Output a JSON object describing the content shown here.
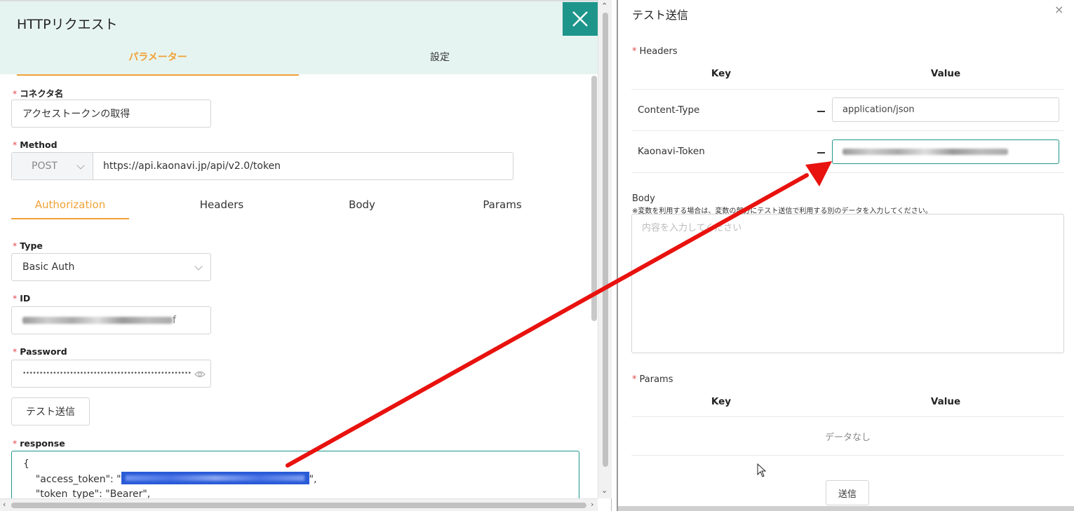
{
  "left": {
    "title": "HTTPリクエスト",
    "tabs": [
      "パラメーター",
      "設定"
    ],
    "connector_label": "コネクタ名",
    "connector_value": "アクセストークンの取得",
    "method_label": "Method",
    "method_value": "POST",
    "url_value": "https://api.kaonavi.jp/api/v2.0/token",
    "sub_tabs": [
      "Authorization",
      "Headers",
      "Body",
      "Params"
    ],
    "type_label": "Type",
    "type_value": "Basic Auth",
    "id_label": "ID",
    "id_suffix": "f",
    "password_label": "Password",
    "password_value": "••••••••••••••••••••••••••••••••••••••••••••••••••••",
    "test_button": "テスト送信",
    "response_label": "response",
    "response_line1": "{",
    "response_key1": "    \"access_token\": \"",
    "response_key1_end": "\",",
    "response_line3": "    \"token_type\": \"Bearer\","
  },
  "right": {
    "title": "テスト送信",
    "close": "×",
    "headers_label": "Headers",
    "key_header": "Key",
    "value_header": "Value",
    "rows": [
      {
        "key": "Content-Type",
        "value": "application/json"
      },
      {
        "key": "Kaonavi-Token",
        "value": ""
      }
    ],
    "body_label": "Body",
    "body_note": "※変数を利用する場合は、変数の部分にテスト送信で利用する別のデータを入力してください。",
    "body_placeholder": "内容を入力してください",
    "params_label": "Params",
    "params_key_header": "Key",
    "params_value_header": "Value",
    "no_data": "データなし",
    "send_button": "送信"
  },
  "colors": {
    "accent_orange": "#f0a236",
    "teal": "#1e958b",
    "header_bg": "#e6f4f1",
    "required_red": "#e5484d",
    "arrow_red": "#e8120e",
    "selection_blue": "#2a5bd7"
  },
  "icons": [
    "close-icon",
    "chevron-down-icon",
    "eye-icon",
    "mouse-cursor-icon",
    "red-arrow"
  ]
}
